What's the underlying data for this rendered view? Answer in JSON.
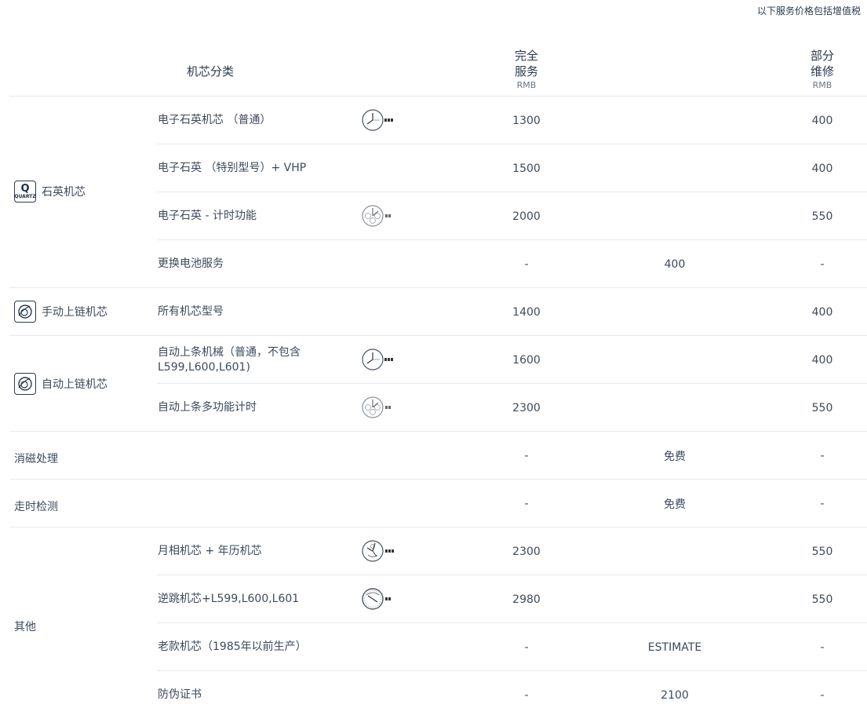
{
  "note": "以下服务价格包括增值税",
  "headers": {
    "category": "机芯分类",
    "full_l1": "完全",
    "full_l2": "服务",
    "full_unit": "RMB",
    "part_l1": "部分",
    "part_l2": "维修",
    "part_unit": "RMB"
  },
  "categories": {
    "quartz": "石英机芯",
    "quartz_icon_q": "Q",
    "quartz_icon_text": "QUARTZ",
    "manual": "手动上链机芯",
    "auto": "自动上链机芯",
    "demag": "消磁处理",
    "timing": "走时检测",
    "other": "其他"
  },
  "rows": [
    {
      "name": "电子石英机芯 （普通）",
      "full": "1300",
      "mid": "",
      "part": "400",
      "icon": "simple-watch-icon"
    },
    {
      "name": "电子石英 （特别型号）+ VHP",
      "full": "1500",
      "mid": "",
      "part": "400",
      "icon": ""
    },
    {
      "name": "电子石英 - 计时功能",
      "full": "2000",
      "mid": "",
      "part": "550",
      "icon": "chronograph-watch-icon"
    },
    {
      "name": "更换电池服务",
      "full": "-",
      "mid": "400",
      "part": "-",
      "icon": ""
    },
    {
      "name": "所有机芯型号",
      "full": "1400",
      "mid": "",
      "part": "400",
      "icon": ""
    },
    {
      "name": "自动上条机械（普通，不包含L599,L600,L601)",
      "full": "1600",
      "mid": "",
      "part": "400",
      "icon": "simple-watch-icon"
    },
    {
      "name": "自动上条多功能计时",
      "full": "2300",
      "mid": "",
      "part": "550",
      "icon": "chronograph-watch-icon"
    },
    {
      "name": "",
      "full": "-",
      "mid": "免费",
      "part": "-",
      "icon": ""
    },
    {
      "name": "",
      "full": "-",
      "mid": "免费",
      "part": "-",
      "icon": ""
    },
    {
      "name": "月相机芯 + 年历机芯",
      "full": "2300",
      "mid": "",
      "part": "550",
      "icon": "moonphase-watch-icon"
    },
    {
      "name": "逆跳机芯+L599,L600,L601",
      "full": "2980",
      "mid": "",
      "part": "550",
      "icon": "retrograde-watch-icon"
    },
    {
      "name": "老款机芯（1985年以前生产）",
      "full": "-",
      "mid": "ESTIMATE",
      "part": "-",
      "icon": ""
    },
    {
      "name": "防伪证书",
      "full": "-",
      "mid": "2100",
      "part": "-",
      "icon": ""
    }
  ]
}
